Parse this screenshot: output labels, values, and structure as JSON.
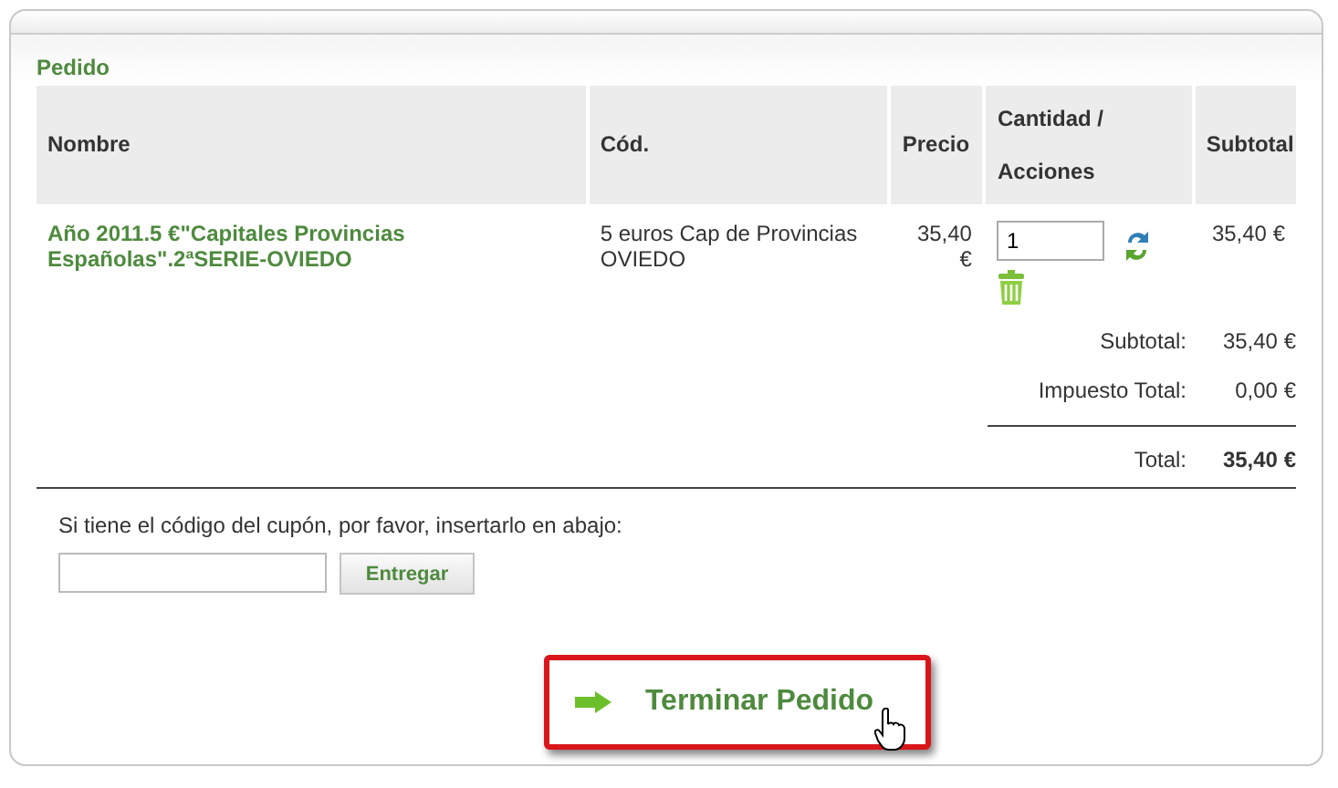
{
  "section_title": "Pedido",
  "table": {
    "columns": [
      "Nombre",
      "Cód.",
      "Precio",
      "Cantidad / Acciones",
      "Subtotal"
    ],
    "rows": [
      {
        "name": "Año 2011.5 €\"Capitales Provincias Españolas\".2ªSERIE-OVIEDO",
        "code": "5 euros Cap de Provincias OVIEDO",
        "price": "35,40 €",
        "quantity": "1",
        "subtotal": "35,40 €"
      }
    ]
  },
  "totals": [
    {
      "label": "Subtotal:",
      "value": "35,40 €",
      "kind": "normal"
    },
    {
      "label": "Impuesto Total:",
      "value": "0,00 €",
      "kind": "normal"
    },
    {
      "label": "Total:",
      "value": "35,40 €",
      "kind": "grand"
    }
  ],
  "coupon": {
    "prompt": "Si tiene el código del cupón, por favor, insertarlo en abajo:",
    "button": "Entregar"
  },
  "checkout_button": {
    "label": "Terminar Pedido",
    "highlighted": true
  }
}
